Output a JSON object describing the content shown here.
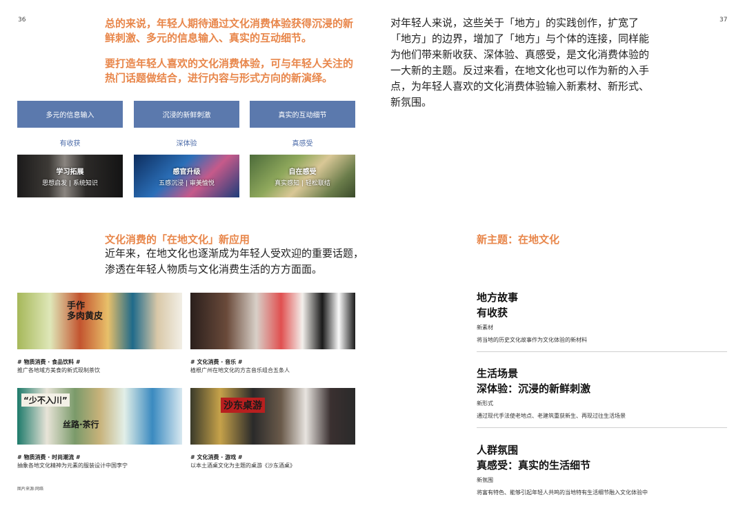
{
  "page_numbers": {
    "left": "36",
    "right": "37"
  },
  "summary": {
    "line1": "总的来说，年轻人期待通过文化消费体验获得沉浸的新鲜刺激、多元的信息输入、真实的互动细节。",
    "line2": "要打造年轻人喜欢的文化消费体验，可与年轻人关注的热门话题做结合，进行内容与形式方向的新演绎。"
  },
  "right_intro": "对年轻人来说，这些关于「地方」的实践创作，扩宽了「地方」的边界，增加了「地方」与个体的连接，同样能为他们带来新收获、深体验、真感受，是文化消费体验的一大新的主题。反过来看，在地文化也可以作为新的入手点，为年轻人喜欢的文化消费体验输入新素材、新形式、新氛围。",
  "pillars": [
    {
      "box": "多元的信息输入",
      "label": "有收获",
      "title": "学习拓展",
      "sub": "思想启发 | 系统知识"
    },
    {
      "box": "沉浸的新鲜刺激",
      "label": "深体验",
      "title": "感官升级",
      "sub": "五感沉浸 | 审美愉悦"
    },
    {
      "box": "真实的互动细节",
      "label": "真感受",
      "title": "自在感受",
      "sub": "真实感知 | 轻松联结"
    }
  ],
  "section": {
    "title": "文化消费的「在地文化」新应用",
    "desc": "近年来，在地文化也逐渐成为年轻人受欢迎的重要话题，渗透在年轻人物质与文化消费生活的方方面面。"
  },
  "photo_text": {
    "p1": "手作\n多肉黄皮",
    "p3a": "“少不入川”",
    "p3b": "丝路·茶行",
    "p4": "沙东桌游"
  },
  "cases": [
    {
      "tag": "# 物质消费 · 食品饮料 #",
      "desc": "推广各地域方美食的新式现制茶饮"
    },
    {
      "tag": "# 文化消费 · 音乐 #",
      "desc": "植根广州在地文化的方言音乐组合五条人"
    },
    {
      "tag": "# 物质消费 · 时尚潮流 #",
      "desc": "抽象各地文化精神为元素的服装设计中国李宁"
    },
    {
      "tag": "# 文化消费 · 游戏 #",
      "desc": "以本土酒桌文化为主题的桌游《沙东酒桌》"
    }
  ],
  "footnote": "图片来源:网络",
  "new_theme": {
    "title": "新主题：在地文化",
    "blocks": [
      {
        "h1": "地方故事",
        "h2": "有收获",
        "k": "新素材",
        "d": "将当地的历史文化故事作为文化体验的新材料"
      },
      {
        "h1": "生活场景",
        "h2": "深体验：沉浸的新鲜刺激",
        "k": "新形式",
        "d": "通过现代手法使老地点、老建筑重获新生、再现过往生活场景"
      },
      {
        "h1": "人群氛围",
        "h2": "真感受：真实的生活细节",
        "k": "新氛围",
        "d": "将富有特色、能够引起年轻人共鸣的当地特有生活细节融入文化体验中"
      }
    ]
  }
}
